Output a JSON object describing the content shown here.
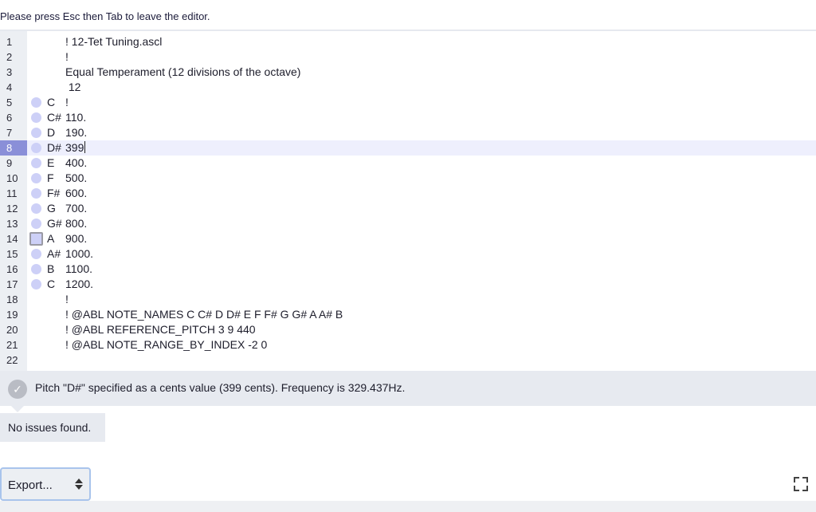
{
  "hint": "Please press Esc then Tab to leave the editor.",
  "editor": {
    "lines": [
      {
        "num": "1",
        "note": "",
        "code": "! 12-Tet Tuning.ascl",
        "marker": ""
      },
      {
        "num": "2",
        "note": "",
        "code": "!",
        "marker": ""
      },
      {
        "num": "3",
        "note": "",
        "code": "Equal Temperament (12 divisions of the octave)",
        "marker": ""
      },
      {
        "num": "4",
        "note": "",
        "code": " 12",
        "marker": ""
      },
      {
        "num": "5",
        "note": "C",
        "code": "!",
        "marker": "circle"
      },
      {
        "num": "6",
        "note": "C#",
        "code": "110.",
        "marker": "circle"
      },
      {
        "num": "7",
        "note": "D",
        "code": "190.",
        "marker": "circle"
      },
      {
        "num": "8",
        "note": "D#",
        "code": "399",
        "marker": "circle",
        "current": true
      },
      {
        "num": "9",
        "note": "E",
        "code": "400.",
        "marker": "circle"
      },
      {
        "num": "10",
        "note": "F",
        "code": "500.",
        "marker": "circle"
      },
      {
        "num": "11",
        "note": "F#",
        "code": "600.",
        "marker": "circle"
      },
      {
        "num": "12",
        "note": "G",
        "code": "700.",
        "marker": "circle"
      },
      {
        "num": "13",
        "note": "G#",
        "code": "800.",
        "marker": "circle"
      },
      {
        "num": "14",
        "note": "A",
        "code": "900.",
        "marker": "square"
      },
      {
        "num": "15",
        "note": "A#",
        "code": "1000.",
        "marker": "circle"
      },
      {
        "num": "16",
        "note": "B",
        "code": "1100.",
        "marker": "circle"
      },
      {
        "num": "17",
        "note": "C",
        "code": "1200.",
        "marker": "circle"
      },
      {
        "num": "18",
        "note": "",
        "code": "!",
        "marker": ""
      },
      {
        "num": "19",
        "note": "",
        "code": "! @ABL NOTE_NAMES C C# D D# E F F# G G# A A# B",
        "marker": ""
      },
      {
        "num": "20",
        "note": "",
        "code": "! @ABL REFERENCE_PITCH 3 9 440",
        "marker": ""
      },
      {
        "num": "21",
        "note": "",
        "code": "! @ABL NOTE_RANGE_BY_INDEX -2 0",
        "marker": ""
      },
      {
        "num": "22",
        "note": "",
        "code": "",
        "marker": ""
      }
    ]
  },
  "status": {
    "message": "Pitch \"D#\" specified as a cents value (399 cents). Frequency is 329.437Hz."
  },
  "issues": {
    "message": "No issues found."
  },
  "export": {
    "label": "Export..."
  },
  "icons": {
    "status": "check-icon",
    "fullscreen": "fullscreen-icon",
    "export": "updown-arrows-icon"
  },
  "colors": {
    "current_line_number_bg": "#8a8fd8",
    "current_line_bg": "#eeeffd",
    "marker": "#cdd0f7"
  }
}
